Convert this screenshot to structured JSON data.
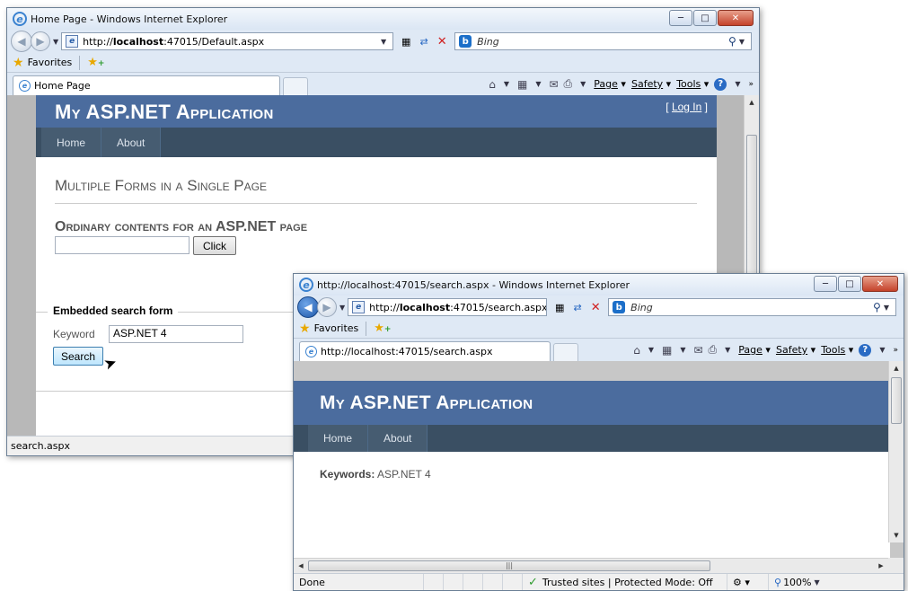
{
  "window1": {
    "title": "Home Page - Windows Internet Explorer",
    "address": {
      "prefix": "http://",
      "host": "localhost",
      "path": ":47015/Default.aspx"
    },
    "search_placeholder": "Bing",
    "favorites_label": "Favorites",
    "tab_label": "Home Page",
    "commands": {
      "page": "Page",
      "safety": "Safety",
      "tools": "Tools"
    },
    "site": {
      "app_title": "My ASP.NET Application",
      "login_label": "Log In",
      "menu": [
        "Home",
        "About"
      ],
      "heading": "Multiple Forms in a Single Page",
      "subheading": "Ordinary contents for an ASP.NET page",
      "click_button": "Click",
      "fieldset_legend": "Embedded search form",
      "keyword_label": "Keyword",
      "keyword_value": "ASP.NET 4",
      "search_button": "Search"
    },
    "status_text": "search.aspx"
  },
  "window2": {
    "title": "http://localhost:47015/search.aspx - Windows Internet Explorer",
    "address": {
      "prefix": "http://",
      "host": "localhost",
      "path": ":47015/search.aspx"
    },
    "search_placeholder": "Bing",
    "favorites_label": "Favorites",
    "tab_label": "http://localhost:47015/search.aspx",
    "commands": {
      "page": "Page",
      "safety": "Safety",
      "tools": "Tools"
    },
    "site": {
      "app_title": "My ASP.NET Application",
      "menu": [
        "Home",
        "About"
      ],
      "keywords_label": "Keywords:",
      "keywords_value": "ASP.NET 4"
    },
    "status": {
      "done": "Done",
      "zone": "Trusted sites | Protected Mode: Off",
      "zoom": "100%"
    }
  },
  "colors": {
    "site_header": "#4b6c9e",
    "site_menu": "#465c71",
    "chrome": "#dfe9f5"
  }
}
